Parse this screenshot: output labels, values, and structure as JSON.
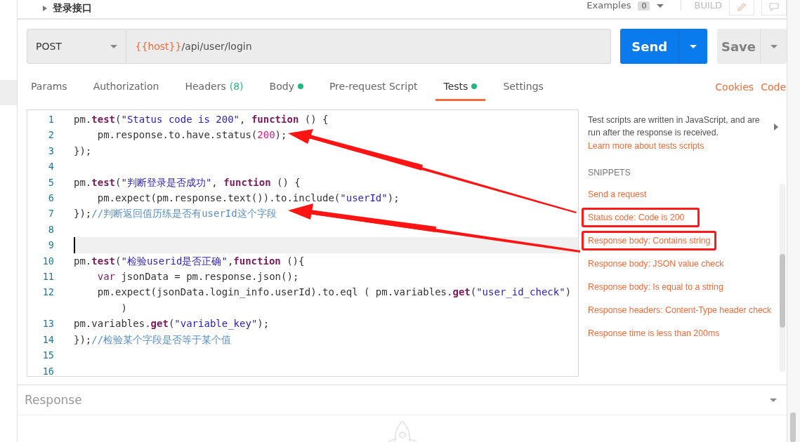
{
  "header": {
    "title": "登录接口",
    "examples_label": "Examples",
    "examples_count": "0",
    "build": "BUILD"
  },
  "request": {
    "method": "POST",
    "url_variable": "{{host}}",
    "url_path": "/api/user/login",
    "send": "Send",
    "save": "Save"
  },
  "tabs": [
    {
      "label": "Params",
      "selected": false
    },
    {
      "label": "Authorization",
      "selected": false
    },
    {
      "label": "Headers",
      "count": "(8)",
      "selected": false
    },
    {
      "label": "Body",
      "dot": true,
      "selected": false
    },
    {
      "label": "Pre-request Script",
      "selected": false
    },
    {
      "label": "Tests",
      "dot": true,
      "selected": true
    },
    {
      "label": "Settings",
      "selected": false
    }
  ],
  "tab_links": [
    "Cookies",
    "Code"
  ],
  "editor": {
    "lines": [
      {
        "number": "1",
        "active": false,
        "tokens": [
          {
            "kind": "plain",
            "text": "pm."
          },
          {
            "kind": "method",
            "text": "test"
          },
          {
            "kind": "plain",
            "text": "("
          },
          {
            "kind": "string",
            "text": "\"Status code is 200\""
          },
          {
            "kind": "plain",
            "text": ", "
          },
          {
            "kind": "keyword",
            "text": "function"
          },
          {
            "kind": "plain",
            "text": " () {"
          }
        ]
      },
      {
        "number": "2",
        "active": false,
        "indented": true,
        "tokens": [
          {
            "kind": "plain",
            "text": "pm.response.to.have.status("
          },
          {
            "kind": "number",
            "text": "200"
          },
          {
            "kind": "plain",
            "text": ");"
          }
        ]
      },
      {
        "number": "3",
        "active": false,
        "tokens": [
          {
            "kind": "plain",
            "text": "});"
          }
        ]
      },
      {
        "number": "4",
        "active": false
      },
      {
        "number": "5",
        "active": false,
        "tokens": [
          {
            "kind": "plain",
            "text": "pm."
          },
          {
            "kind": "method",
            "text": "test"
          },
          {
            "kind": "plain",
            "text": "("
          },
          {
            "kind": "string",
            "text": "\"判断登录是否成功\""
          },
          {
            "kind": "plain",
            "text": ", "
          },
          {
            "kind": "keyword",
            "text": "function"
          },
          {
            "kind": "plain",
            "text": " () {"
          }
        ]
      },
      {
        "number": "6",
        "active": false,
        "indented": true,
        "tokens": [
          {
            "kind": "plain",
            "text": "pm.expect(pm.response.text()).to.include("
          },
          {
            "kind": "string",
            "text": "\"userId\""
          },
          {
            "kind": "plain",
            "text": ");"
          }
        ]
      },
      {
        "number": "7",
        "active": false,
        "tokens": [
          {
            "kind": "plain",
            "text": "});"
          },
          {
            "kind": "comment",
            "text": "//判断返回值历练是否有userId这个字段"
          }
        ]
      },
      {
        "number": "8",
        "active": false
      },
      {
        "number": "9",
        "active": true
      },
      {
        "number": "10",
        "active": false,
        "tokens": [
          {
            "kind": "plain",
            "text": "pm."
          },
          {
            "kind": "method",
            "text": "test"
          },
          {
            "kind": "plain",
            "text": "("
          },
          {
            "kind": "string",
            "text": "\"检验userid是否正确\""
          },
          {
            "kind": "plain",
            "text": ","
          },
          {
            "kind": "keyword",
            "text": "function"
          },
          {
            "kind": "plain",
            "text": " (){"
          }
        ]
      },
      {
        "number": "11",
        "active": false,
        "indented": true,
        "tokens": [
          {
            "kind": "storage",
            "text": "var"
          },
          {
            "kind": "plain",
            "text": " jsonData = pm.response.json();"
          }
        ]
      },
      {
        "number": "12",
        "active": false,
        "indented": true,
        "tokens": [
          {
            "kind": "plain",
            "text": "pm.expect(jsonData.login_info.userId).to.eql ( pm.variables."
          },
          {
            "kind": "method",
            "text": "get"
          },
          {
            "kind": "plain",
            "text": "("
          },
          {
            "kind": "string",
            "text": "\"user_id_check\""
          },
          {
            "kind": "plain",
            "text": ") )"
          }
        ]
      },
      {
        "number": "13",
        "active": false,
        "tokens": [
          {
            "kind": "plain",
            "text": "pm.variables."
          },
          {
            "kind": "method",
            "text": "get"
          },
          {
            "kind": "plain",
            "text": "("
          },
          {
            "kind": "string",
            "text": "\"variable_key\""
          },
          {
            "kind": "plain",
            "text": ");"
          }
        ]
      },
      {
        "number": "14",
        "active": false,
        "tokens": [
          {
            "kind": "plain",
            "text": "});"
          },
          {
            "kind": "comment",
            "text": "//检验某个字段是否等于某个值"
          }
        ]
      },
      {
        "number": "15",
        "active": false
      },
      {
        "number": "16",
        "active": false
      }
    ]
  },
  "sidebar": {
    "description": "Test scripts are written in JavaScript, and are run after the response is received.",
    "learn_more": "Learn more about tests scripts",
    "snippets_heading": "SNIPPETS",
    "snippets": [
      {
        "label": "Send a request",
        "highlighted": false
      },
      {
        "label": "Status code: Code is 200",
        "highlighted": true
      },
      {
        "label": "Response body: Contains string",
        "highlighted": true
      },
      {
        "label": "Response body: JSON value check",
        "highlighted": false
      },
      {
        "label": "Response body: Is equal to a string",
        "highlighted": false
      },
      {
        "label": "Response headers: Content-Type header check",
        "highlighted": false
      },
      {
        "label": "Response time is less than 200ms",
        "highlighted": false
      }
    ]
  },
  "response": {
    "title": "Response"
  }
}
